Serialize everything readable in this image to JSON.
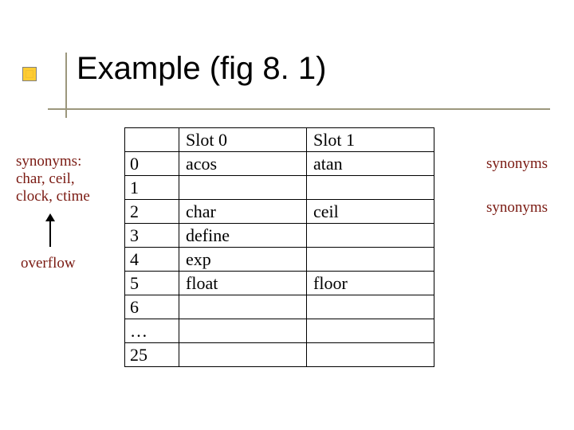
{
  "title": "Example (fig 8. 1)",
  "leftNote": {
    "line1": "synonyms:",
    "line2": "char, ceil,",
    "line3": "clock, ctime"
  },
  "overflowLabel": "overflow",
  "rightNote1": "synonyms",
  "rightNote2": "synonyms",
  "table": {
    "hdr_blank": "",
    "hdr_slot0": "Slot 0",
    "hdr_slot1": "Slot 1",
    "rows": [
      {
        "idx": "0",
        "a": "acos",
        "b": "atan"
      },
      {
        "idx": "1",
        "a": "",
        "b": ""
      },
      {
        "idx": "2",
        "a": "char",
        "b": "ceil"
      },
      {
        "idx": "3",
        "a": "define",
        "b": ""
      },
      {
        "idx": "4",
        "a": "exp",
        "b": ""
      },
      {
        "idx": "5",
        "a": "float",
        "b": "floor"
      },
      {
        "idx": "6",
        "a": "",
        "b": ""
      },
      {
        "idx": "…",
        "a": "",
        "b": ""
      },
      {
        "idx": "25",
        "a": "",
        "b": ""
      }
    ]
  }
}
